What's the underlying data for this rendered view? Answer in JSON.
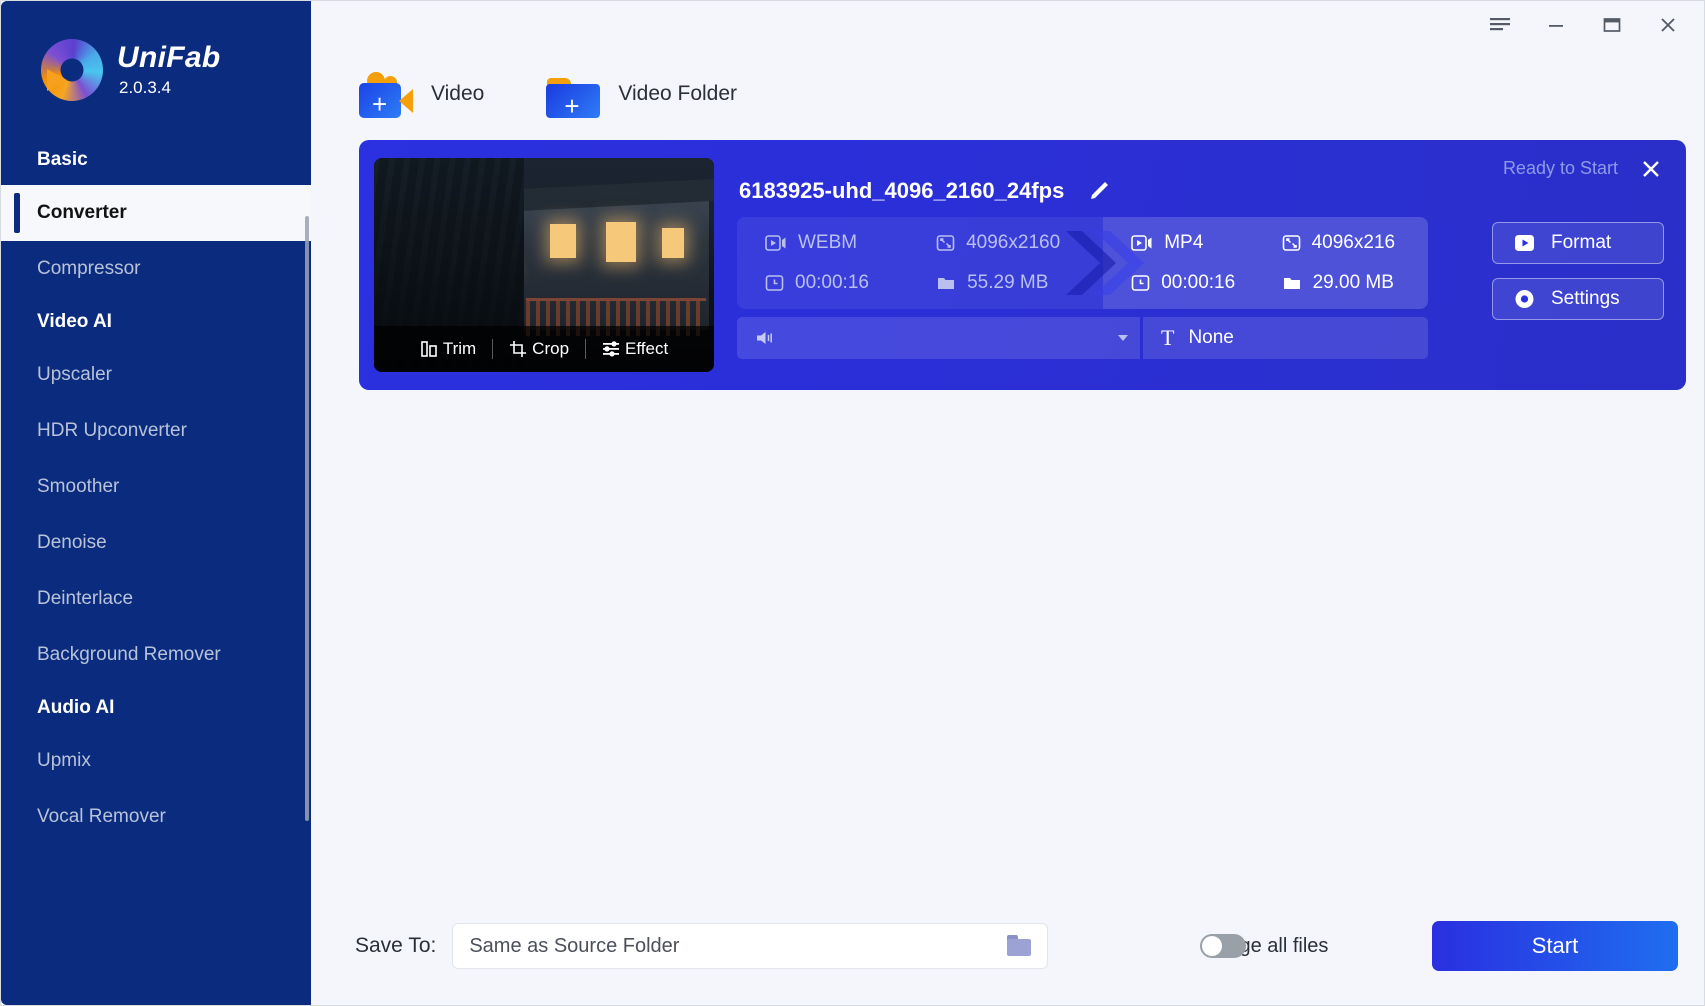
{
  "sidebar": {
    "brand_name": "UniFab",
    "version": "2.0.3.4",
    "groups": [
      {
        "title": "Basic",
        "items": [
          {
            "label": "Converter",
            "active": true
          },
          {
            "label": "Compressor",
            "active": false
          }
        ]
      },
      {
        "title": "Video AI",
        "items": [
          {
            "label": "Upscaler",
            "active": false
          },
          {
            "label": "HDR Upconverter",
            "active": false
          },
          {
            "label": "Smoother",
            "active": false
          },
          {
            "label": "Denoise",
            "active": false
          },
          {
            "label": "Deinterlace",
            "active": false
          },
          {
            "label": "Background Remover",
            "active": false
          }
        ]
      },
      {
        "title": "Audio AI",
        "items": [
          {
            "label": "Upmix",
            "active": false
          },
          {
            "label": "Vocal Remover",
            "active": false
          }
        ]
      }
    ]
  },
  "titlebar": {
    "menu_icon": "hamburger-icon",
    "minimize_icon": "minimize-icon",
    "maximize_icon": "maximize-icon",
    "close_icon": "close-icon"
  },
  "toolbar": {
    "add_video_label": "Video",
    "add_video_folder_label": "Video Folder"
  },
  "task": {
    "status": "Ready to Start",
    "filename": "6183925-uhd_4096_2160_24fps",
    "thumb_tools": [
      {
        "label": "Trim",
        "icon": "trim-icon"
      },
      {
        "label": "Crop",
        "icon": "crop-icon"
      },
      {
        "label": "Effect",
        "icon": "effect-icon"
      }
    ],
    "source": {
      "format": "WEBM",
      "resolution": "4096x2160",
      "duration": "00:00:16",
      "size": "55.29 MB"
    },
    "output": {
      "format": "MP4",
      "resolution": "4096x216",
      "duration": "00:00:16",
      "size": "29.00 MB"
    },
    "audio_track": "",
    "subtitle_track": "None",
    "format_button": "Format",
    "settings_button": "Settings"
  },
  "bottom": {
    "save_to_label": "Save To:",
    "save_to_value": "Same as Source Folder",
    "merge_label": "Merge all files",
    "merge_enabled": false,
    "start_label": "Start"
  },
  "colors": {
    "sidebar_bg": "#0b2c7e",
    "card_bg": "#2b30e0",
    "accent": "#1f6ef0",
    "page_bg": "#f4f6fb"
  }
}
